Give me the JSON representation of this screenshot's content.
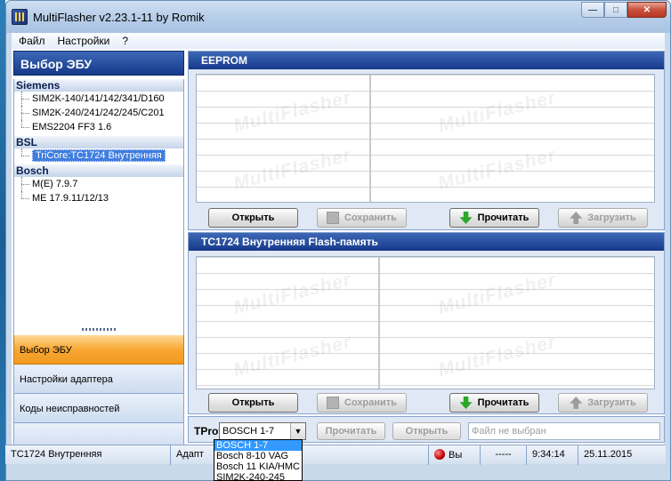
{
  "window": {
    "title": "MultiFlasher v2.23.1-11 by Romik"
  },
  "menu": [
    "Файл",
    "Настройки",
    "?"
  ],
  "left": {
    "header": "Выбор ЭБУ",
    "groups": [
      {
        "name": "Siemens",
        "items": [
          "SIM2K-140/141/142/341/D160",
          "SIM2K-240/241/242/245/C201",
          "EMS2204 FF3 1.6"
        ]
      },
      {
        "name": "BSL",
        "items": [
          "TriCore:TC1724 Внутренняя"
        ]
      },
      {
        "name": "Bosch",
        "items": [
          "M(E) 7.9.7",
          "ME 17.9.11/12/13"
        ]
      }
    ],
    "selected_item": "TriCore:TC1724 Внутренняя",
    "nav": [
      "Выбор ЭБУ",
      "Настройки адаптера",
      "Коды неисправностей"
    ],
    "active_nav": "Выбор ЭБУ"
  },
  "eeprom": {
    "title": "EEPROM",
    "buttons": {
      "open": "Открыть",
      "save": "Сохранить",
      "read": "Прочитать",
      "write": "Загрузить"
    }
  },
  "flash": {
    "title": "TC1724 Внутренняя Flash-память",
    "buttons": {
      "open": "Открыть",
      "save": "Сохранить",
      "read": "Прочитать",
      "write": "Загрузить"
    }
  },
  "watermark": "MultiFlasher",
  "bottom": {
    "tprot_label": "TProt",
    "tprot_value": "BOSCH 1-7",
    "read": "Прочитать",
    "open": "Открыть",
    "file_placeholder": "Файл не выбран"
  },
  "dropdown": [
    "BOSCH 1-7",
    "Bosch 8-10 VAG",
    "Bosch 11 KIA/HMC",
    "SIM2K-240-245"
  ],
  "status": {
    "ecu": "TC1724 Внутренняя",
    "adapter": "Адапт",
    "connection": "Вы",
    "dashes": "-----",
    "time": "9:34:14",
    "date": "25.11.2015"
  },
  "colors": {
    "header_blue": "#16398a",
    "active_orange": "#f7a733",
    "selection": "#3f7de0"
  }
}
